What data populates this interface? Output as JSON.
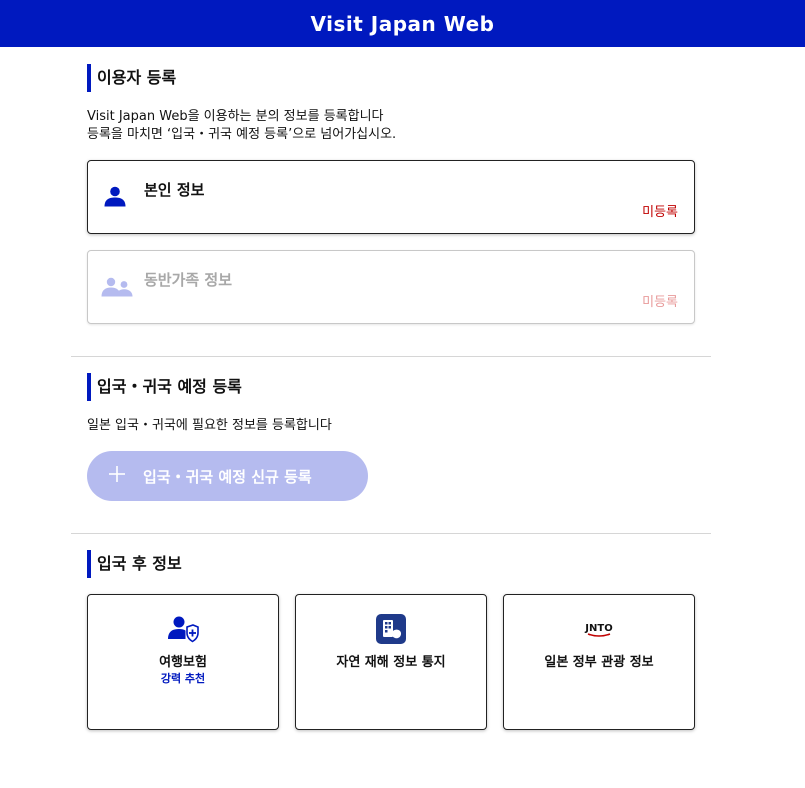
{
  "app": {
    "title": "Visit Japan Web"
  },
  "colors": {
    "brand": "#0019bf",
    "status_unregistered": "#c00000",
    "button_disabled": "#b5bbef"
  },
  "user_registration": {
    "title": "이용자 등록",
    "description_line1": "Visit Japan Web을 이용하는 분의 정보를 등록합니다",
    "description_line2": "등록을 마치면 ‘입국・귀국 예정 등록’으로 넘어가십시오.",
    "cards": [
      {
        "label": "본인 정보",
        "status": "미등록",
        "icon": "person-icon",
        "enabled": true
      },
      {
        "label": "동반가족 정보",
        "status": "미등록",
        "icon": "family-icon",
        "enabled": false
      }
    ]
  },
  "entry_registration": {
    "title": "입국・귀국 예정 등록",
    "description": "일본 입국・귀국에 필요한 정보를 등록합니다",
    "new_button_label": "입국・귀국 예정 신규 등록",
    "new_button_icon": "plus-icon"
  },
  "after_entry": {
    "title": "입국 후 정보",
    "tiles": [
      {
        "label": "여행보험",
        "sublabel": "강력 추천",
        "icon": "insurance-person-shield-icon"
      },
      {
        "label": "자연 재해 정보 통지",
        "icon": "disaster-app-icon"
      },
      {
        "label": "일본 정부 관광 정보",
        "icon": "jnto-logo-icon",
        "logo_text": "JNTO"
      }
    ]
  }
}
